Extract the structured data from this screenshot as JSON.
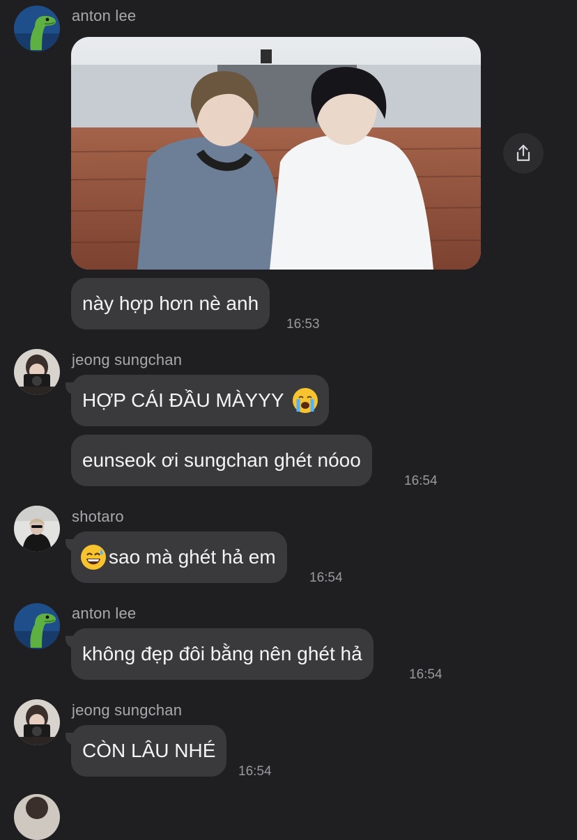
{
  "messages": [
    {
      "sender": "anton lee",
      "text": "này hợp hơn nè anh",
      "time": "16:53"
    },
    {
      "sender": "jeong sungchan",
      "text1": "HỢP CÁI ĐẦU MÀYYY",
      "text2": "eunseok ơi sungchan ghét nóoo",
      "time": "16:54"
    },
    {
      "sender": "shotaro",
      "text": "sao mà ghét hả em",
      "time": "16:54"
    },
    {
      "sender": "anton lee",
      "text": "không đẹp đôi bằng nên ghét hả",
      "time": "16:54"
    },
    {
      "sender": "jeong sungchan",
      "text": "CÒN LÂU NHÉ",
      "time": "16:54"
    }
  ],
  "icons": {
    "share": "share-icon",
    "crying_emoji": "loudly-crying-face-emoji",
    "sweat_emoji": "grinning-sweat-face-emoji"
  },
  "colors": {
    "background": "#1f1f21",
    "bubble": "#3a3a3d",
    "sender_name": "#a9a9ad",
    "timestamp": "#9a9a9e"
  }
}
